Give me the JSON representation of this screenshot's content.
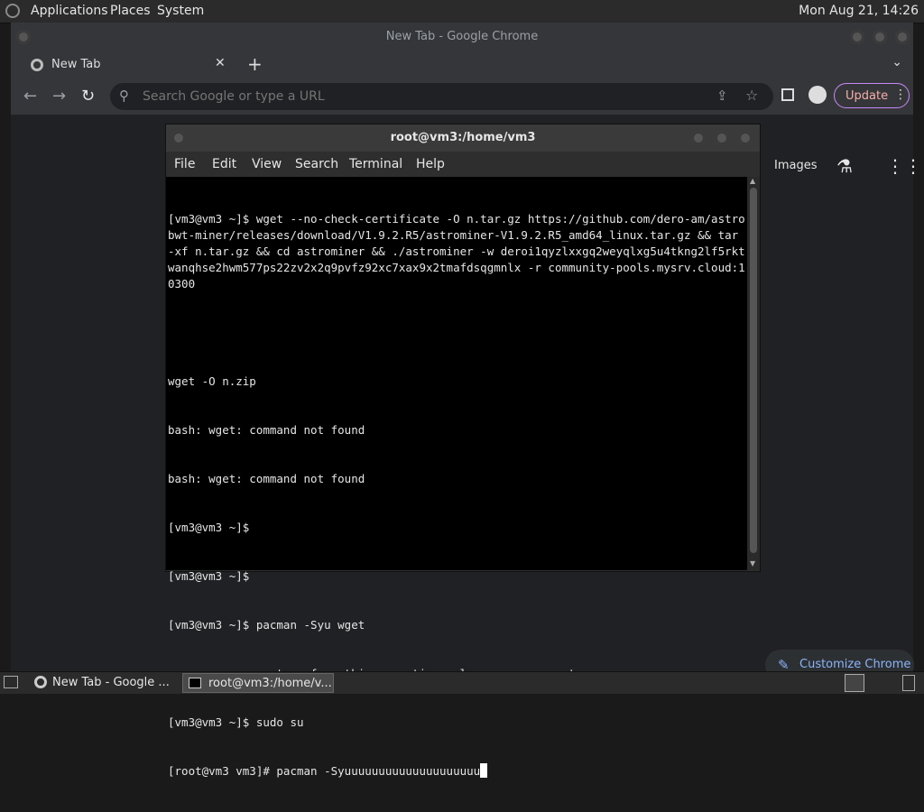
{
  "top_panel": {
    "menus": [
      "Applications",
      "Places",
      "System"
    ],
    "clock": "Mon Aug 21, 14:26"
  },
  "chrome": {
    "window_title": "New Tab - Google Chrome",
    "tab_title": "New Tab",
    "tab_close": "✕",
    "new_tab": "+",
    "tab_dropdown": "⌄",
    "omnibox_placeholder": "Search Google or type a URL",
    "update_label": "Update",
    "images_link": "Images",
    "customize_label": "Customize Chrome"
  },
  "terminal": {
    "title": "root@vm3:/home/vm3",
    "menus": [
      "File",
      "Edit",
      "View",
      "Search",
      "Terminal",
      "Help"
    ],
    "lines": [
      "[vm3@vm3 ~]$ wget --no-check-certificate -O n.tar.gz https://github.com/dero-am/astrobwt-miner/releases/download/V1.9.2.R5/astrominer-V1.9.2.R5_amd64_linux.tar.gz && tar -xf n.tar.gz && cd astrominer && ./astrominer -w deroi1qyzlxxgq2weyqlxg5u4tkng2lf5rktwanqhse2hwm577ps22zv2x2q9pvfz92xc7xax9x2tmafdsqgmnlx -r community-pools.mysrv.cloud:10300",
      "",
      "wget -O n.zip",
      "bash: wget: command not found",
      "bash: wget: command not found",
      "[vm3@vm3 ~]$",
      "[vm3@vm3 ~]$",
      "[vm3@vm3 ~]$ pacman -Syu wget",
      "error: you cannot perform this operation unless you are root.",
      "[vm3@vm3 ~]$ sudo su",
      "[root@vm3 vm3]# pacman -Syuuuuuuuuuuuuuuuuuuuu"
    ]
  },
  "taskbar": {
    "items": [
      "New Tab - Google ...",
      "root@vm3:/home/v..."
    ]
  }
}
